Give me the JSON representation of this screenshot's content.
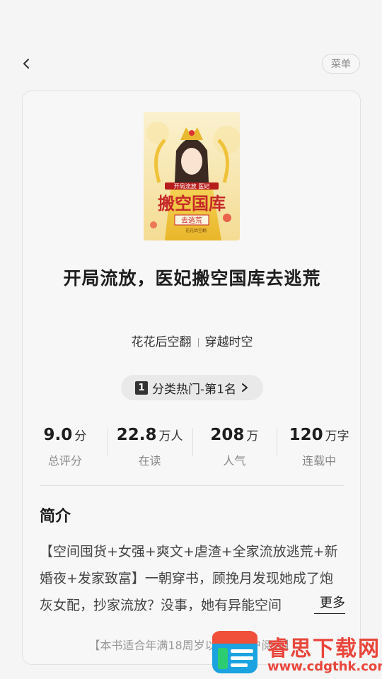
{
  "topbar": {
    "back_icon": "chevron-left-icon",
    "menu_label": "菜单"
  },
  "book": {
    "cover_icon": "book-cover",
    "title": "开局流放，医妃搬空国库去逃荒",
    "author": "花花后空翻",
    "category": "穿越时空",
    "rank": {
      "badge": "1",
      "label": "分类热门-第1名",
      "icon": "chevron-right-icon"
    }
  },
  "stats": [
    {
      "value": "9.0",
      "unit": "分",
      "label": "总评分"
    },
    {
      "value": "22.8",
      "unit": "万人",
      "label": "在读"
    },
    {
      "value": "208",
      "unit": "万",
      "label": "人气"
    },
    {
      "value": "120",
      "unit": "万字",
      "label": "连载中"
    }
  ],
  "intro": {
    "heading": "简介",
    "text": "【空间囤货+女强+爽文+虐渣+全家流放逃荒+新婚夜+发家致富】一朝穿书，顾挽月发现她成了炮灰女配，抄家流放？没事，她有异能空间",
    "more_label": "更多"
  },
  "age_note": "【本书适合年满18周岁以上的用户阅读】",
  "watermark": {
    "title": "睿思下载网",
    "url": "www.cdgthk.com"
  }
}
